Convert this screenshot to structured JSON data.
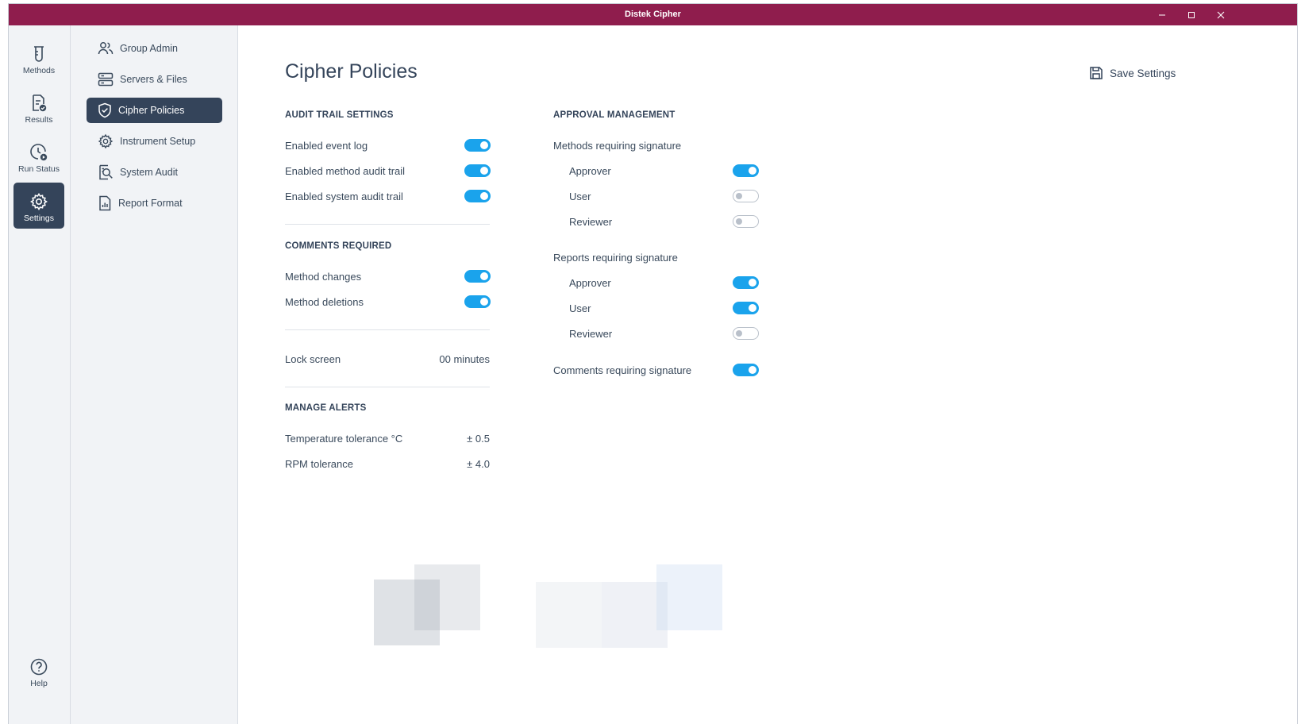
{
  "window": {
    "title": "Distek Cipher"
  },
  "rail": [
    {
      "label": "Methods",
      "icon": "beaker-icon"
    },
    {
      "label": "Results",
      "icon": "document-check-icon"
    },
    {
      "label": "Run Status",
      "icon": "clock-play-icon"
    },
    {
      "label": "Settings",
      "icon": "gear-icon",
      "active": true
    },
    {
      "label": "Help",
      "icon": "help-circle-icon"
    }
  ],
  "subnav": [
    {
      "label": "Group Admin",
      "icon": "users-icon"
    },
    {
      "label": "Servers & Files",
      "icon": "server-icon"
    },
    {
      "label": "Cipher Policies",
      "icon": "shield-check-icon",
      "active": true
    },
    {
      "label": "Instrument Setup",
      "icon": "gear-icon"
    },
    {
      "label": "System Audit",
      "icon": "audit-search-icon"
    },
    {
      "label": "Report Format",
      "icon": "report-icon"
    }
  ],
  "page": {
    "title": "Cipher Policies",
    "save_label": "Save Settings"
  },
  "audit": {
    "heading": "AUDIT TRAIL SETTINGS",
    "items": [
      {
        "label": "Enabled event log",
        "on": true
      },
      {
        "label": "Enabled method audit trail",
        "on": true
      },
      {
        "label": "Enabled system audit trail",
        "on": true
      }
    ]
  },
  "comments": {
    "heading": "COMMENTS REQUIRED",
    "items": [
      {
        "label": "Method changes",
        "on": true
      },
      {
        "label": "Method deletions",
        "on": true
      }
    ]
  },
  "lock": {
    "label": "Lock screen",
    "value": "00 minutes"
  },
  "alerts": {
    "heading": "MANAGE ALERTS",
    "items": [
      {
        "label": "Temperature tolerance °C",
        "value": "± 0.5"
      },
      {
        "label": "RPM tolerance",
        "value": "± 4.0"
      }
    ]
  },
  "approval": {
    "heading": "APPROVAL MANAGEMENT",
    "methods": {
      "label": "Methods requiring signature",
      "items": [
        {
          "label": "Approver",
          "on": true
        },
        {
          "label": "User",
          "on": false
        },
        {
          "label": "Reviewer",
          "on": false
        }
      ]
    },
    "reports": {
      "label": "Reports requiring signature",
      "items": [
        {
          "label": "Approver",
          "on": true
        },
        {
          "label": "User",
          "on": true
        },
        {
          "label": "Reviewer",
          "on": false
        }
      ]
    },
    "comments": {
      "label": "Comments requiring signature",
      "on": true
    }
  },
  "colors": {
    "titlebar": "#8f1d4d",
    "nav_active": "#34445a",
    "toggle_on": "#1aa3ec",
    "toggle_off_border": "#b9c0ca"
  }
}
